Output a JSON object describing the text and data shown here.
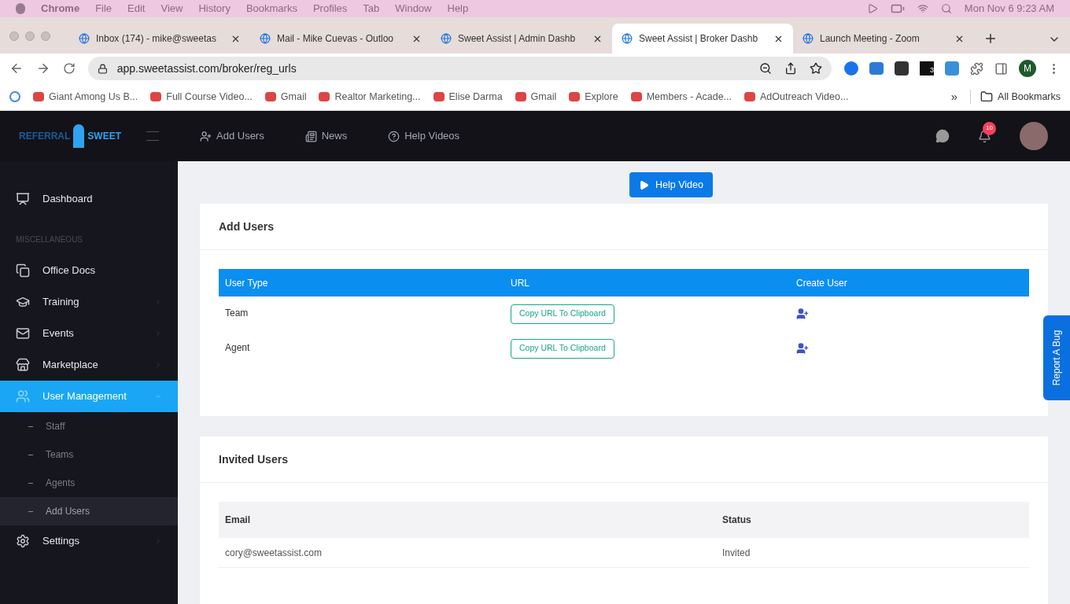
{
  "menubar": {
    "app": "Chrome",
    "items": [
      "File",
      "Edit",
      "View",
      "History",
      "Bookmarks",
      "Profiles",
      "Tab",
      "Window",
      "Help"
    ],
    "clock": "Mon Nov 6  9:23 AM"
  },
  "tabs": [
    {
      "title": "Inbox (174) - mike@sweetas",
      "selected": false
    },
    {
      "title": "Mail - Mike Cuevas - Outloo",
      "selected": false
    },
    {
      "title": "Sweet Assist | Admin Dashb",
      "selected": false
    },
    {
      "title": "Sweet Assist | Broker Dashb",
      "selected": true
    },
    {
      "title": "Launch Meeting - Zoom",
      "selected": false
    }
  ],
  "address": "app.sweetassist.com/broker/reg_urls",
  "profile_initial": "M",
  "extension_badge": "3",
  "bookmarks": [
    "Giant Among Us B...",
    "Full Course Video...",
    "Gmail",
    "Realtor Marketing...",
    "Elise Darma",
    "Gmail",
    "Explore",
    "Members - Acade...",
    "AdOutreach Video..."
  ],
  "all_bookmarks": "All Bookmarks",
  "more_bookmarks": "»",
  "app": {
    "logo_left": "REFERRAL",
    "logo_right": "SWEET",
    "nav": [
      "Add Users",
      "News",
      "Help Videos"
    ],
    "notification_count": "10"
  },
  "sidebar": [
    {
      "kind": "item",
      "label": "Dashboard",
      "selected": false
    },
    {
      "kind": "section",
      "label": "MISCELLANEOUS"
    },
    {
      "kind": "item",
      "label": "Office Docs",
      "selected": false
    },
    {
      "kind": "item",
      "label": "Training",
      "selected": false,
      "expanded": false
    },
    {
      "kind": "item",
      "label": "Events",
      "selected": false,
      "expanded": false
    },
    {
      "kind": "item",
      "label": "Marketplace",
      "selected": false,
      "expanded": false
    },
    {
      "kind": "item",
      "label": "User Management",
      "selected": true,
      "expanded": true,
      "children": [
        {
          "label": "Staff",
          "selected": false
        },
        {
          "label": "Teams",
          "selected": false
        },
        {
          "label": "Agents",
          "selected": false
        },
        {
          "label": "Add Users",
          "selected": true
        }
      ]
    },
    {
      "kind": "item",
      "label": "Settings",
      "selected": false,
      "expanded": false
    }
  ],
  "help_button": "Help Video",
  "add_users": {
    "title": "Add Users",
    "columns": [
      "User Type",
      "URL",
      "Create User"
    ],
    "rows": [
      {
        "type": "Team",
        "button": "Copy URL To Clipboard"
      },
      {
        "type": "Agent",
        "button": "Copy URL To Clipboard"
      }
    ]
  },
  "invited_users": {
    "title": "Invited Users",
    "columns": [
      "Email",
      "Status"
    ],
    "rows": [
      {
        "email": "cory@sweetassist.com",
        "status": "Invited"
      }
    ]
  },
  "report_bug": "Report A Bug"
}
